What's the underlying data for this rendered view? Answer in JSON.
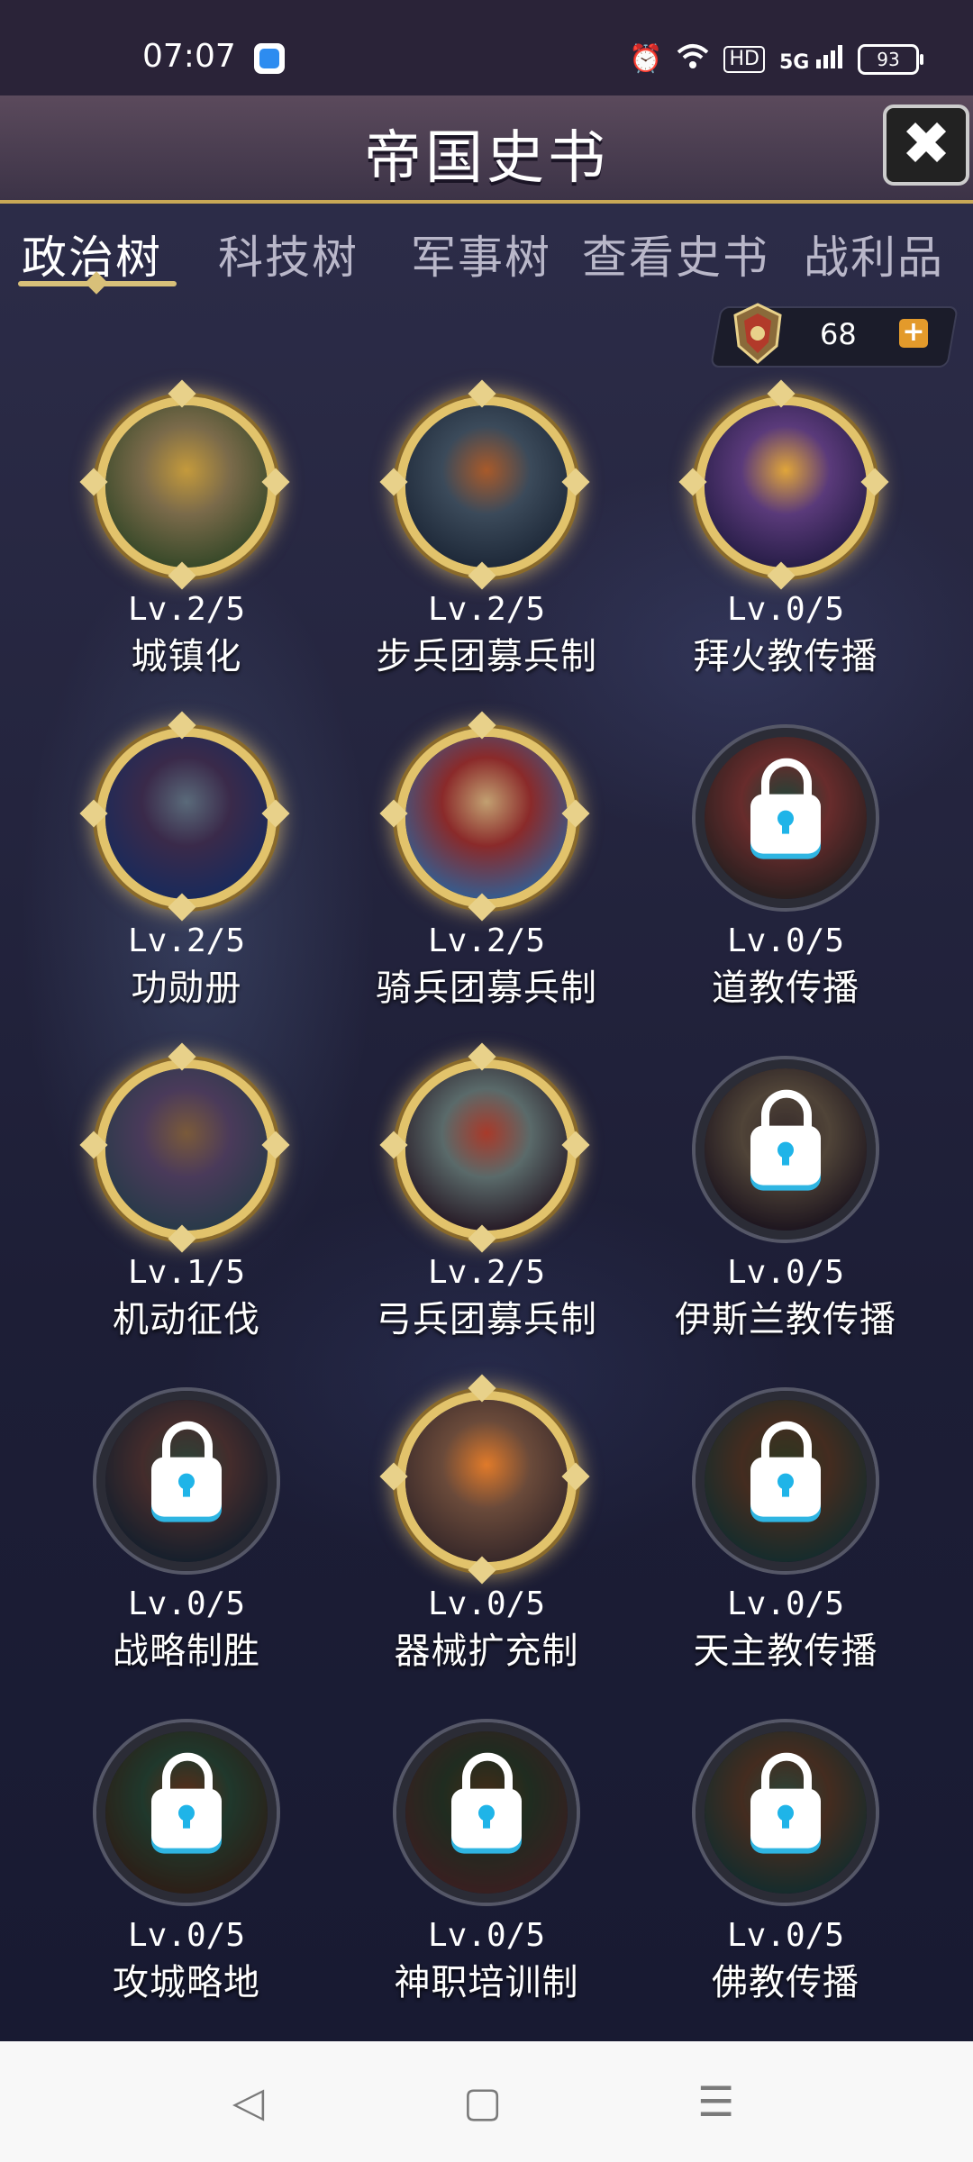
{
  "status_bar": {
    "time": "07:07",
    "hd": "HD",
    "signal": "5G",
    "battery": "93"
  },
  "header": {
    "title": "帝国史书",
    "close_icon": "close-icon"
  },
  "tabs": [
    {
      "label": "政治树",
      "active": true
    },
    {
      "label": "科技树",
      "active": false
    },
    {
      "label": "军事树",
      "active": false
    },
    {
      "label": "查看史书",
      "active": false
    },
    {
      "label": "战利品",
      "active": false
    }
  ],
  "points": {
    "value": "68",
    "plus": "+"
  },
  "nodes": [
    {
      "level": "Lv.2/5",
      "name": "城镇化",
      "locked": false,
      "colors": [
        "#3a4a2a",
        "#c49a3c",
        "#7a6a4a"
      ]
    },
    {
      "level": "Lv.2/5",
      "name": "步兵团募兵制",
      "locked": false,
      "colors": [
        "#1f2a3a",
        "#a85a2a",
        "#3b4a5a"
      ]
    },
    {
      "level": "Lv.0/5",
      "name": "拜火教传播",
      "locked": false,
      "colors": [
        "#2a1f4a",
        "#e0a53a",
        "#5a3a7a"
      ]
    },
    {
      "level": "Lv.2/5",
      "name": "功勋册",
      "locked": false,
      "colors": [
        "#1b2a5a",
        "#5a6a7a",
        "#3a2a4a"
      ]
    },
    {
      "level": "Lv.2/5",
      "name": "骑兵团募兵制",
      "locked": false,
      "colors": [
        "#3a5a8a",
        "#c2a071",
        "#8a2a2a"
      ]
    },
    {
      "level": "Lv.0/5",
      "name": "道教传播",
      "locked": true,
      "colors": [
        "#3a2a2a",
        "#2a5a4a",
        "#8a3a3a"
      ]
    },
    {
      "level": "Lv.1/5",
      "name": "机动征伐",
      "locked": false,
      "colors": [
        "#2a3a4a",
        "#7a5a3a",
        "#4a3a5a"
      ]
    },
    {
      "level": "Lv.2/5",
      "name": "弓兵团募兵制",
      "locked": false,
      "colors": [
        "#2a1f2a",
        "#a83a2a",
        "#5a6a6a"
      ]
    },
    {
      "level": "Lv.0/5",
      "name": "伊斯兰教传播",
      "locked": true,
      "colors": [
        "#2a1f2a",
        "#4a3a3a",
        "#6a5a4a"
      ]
    },
    {
      "level": "Lv.0/5",
      "name": "战略制胜",
      "locked": true,
      "colors": [
        "#1f2a3a",
        "#3a5a4a",
        "#5a3a3a"
      ]
    },
    {
      "level": "Lv.0/5",
      "name": "器械扩充制",
      "locked": false,
      "colors": [
        "#3a2a2a",
        "#e07a2a",
        "#6a4a3a"
      ]
    },
    {
      "level": "Lv.0/5",
      "name": "天主教传播",
      "locked": true,
      "colors": [
        "#1f3a3a",
        "#3a4a2a",
        "#5a3a2a"
      ]
    },
    {
      "level": "Lv.0/5",
      "name": "攻城略地",
      "locked": true,
      "colors": [
        "#3a2a1f",
        "#7a3a1f",
        "#2a4a3a"
      ]
    },
    {
      "level": "Lv.0/5",
      "name": "神职培训制",
      "locked": true,
      "colors": [
        "#4a2a2a",
        "#5a3a1f",
        "#2a3a2a"
      ]
    },
    {
      "level": "Lv.0/5",
      "name": "佛教传播",
      "locked": true,
      "colors": [
        "#1f3a3a",
        "#3a5a4a",
        "#5a3a2a"
      ]
    }
  ],
  "navbar": {
    "back": "◁",
    "home": "▢",
    "menu": "☰"
  }
}
